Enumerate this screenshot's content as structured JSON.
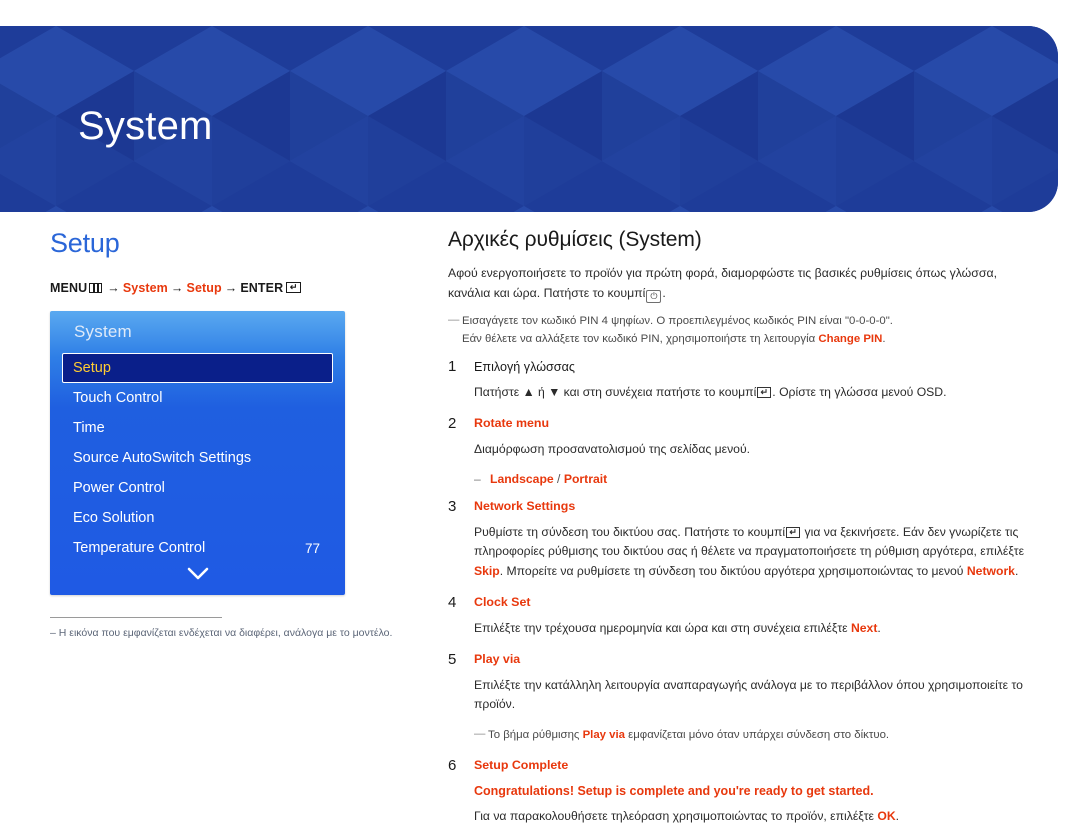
{
  "header": {
    "title": "System",
    "bg_color": "#1e3d99"
  },
  "left": {
    "section_title": "Setup",
    "breadcrumb": {
      "menu_label": "MENU",
      "menu_icon": "grid-lines-icon",
      "arrow": "→",
      "crumb1": "System",
      "crumb2": "Setup",
      "enter_label": "ENTER",
      "enter_icon": "enter-key-icon"
    },
    "osd": {
      "title": "System",
      "items": [
        {
          "label": "Setup",
          "value": "",
          "selected": true
        },
        {
          "label": "Touch Control",
          "value": "",
          "selected": false
        },
        {
          "label": "Time",
          "value": "",
          "selected": false
        },
        {
          "label": "Source AutoSwitch Settings",
          "value": "",
          "selected": false
        },
        {
          "label": "Power Control",
          "value": "",
          "selected": false
        },
        {
          "label": "Eco Solution",
          "value": "",
          "selected": false
        },
        {
          "label": "Temperature Control",
          "value": "77",
          "selected": false
        }
      ],
      "scroll_down_icon": "chevron-down-icon"
    },
    "footnote": "–  Η εικόνα που εμφανίζεται ενδέχεται να διαφέρει, ανάλογα με το μοντέλο."
  },
  "right": {
    "title": "Αρχικές ρυθμίσεις (System)",
    "intro_part1": "Αφού ενεργοποιήσετε το προϊόν για πρώτη φορά, διαμορφώστε τις βασικές ρυθμίσεις όπως γλώσσα, κανάλια και ώρα. Πατήστε το κουμπί",
    "intro_part2": ".",
    "power_icon": "power-button-icon",
    "pin_note_line1": "Εισαγάγετε τον κωδικό PIN 4 ψηφίων. Ο προεπιλεγμένος κωδικός PIN είναι \"0-0-0-0\".",
    "pin_note_line2_a": "Εάν θέλετε να αλλάξετε τον κωδικό PIN, χρησιμοποιήστε τη λειτουργία",
    "pin_note_line2_red": "Change PIN",
    "pin_note_line2_b": ".",
    "steps": [
      {
        "num": "1",
        "head": "Επιλογή γλώσσας",
        "head_red": false,
        "body_a": "Πατήστε ▲ ή ▼ και στη συνέχεια πατήστε το κουμπί",
        "body_b": ". Ορίστε τη γλώσσα μενού OSD."
      },
      {
        "num": "2",
        "head": "Rotate menu",
        "head_red": true,
        "body_a": "Διαμόρφωση προσανατολισμού της σελίδας μενού.",
        "bullet_left": "Landscape",
        "bullet_sep": " / ",
        "bullet_right": "Portrait"
      },
      {
        "num": "3",
        "head": "Network Settings",
        "head_red": true,
        "body_a": "Ρυθμίστε τη σύνδεση του δικτύου σας. Πατήστε το κουμπί",
        "body_b": " για να ξεκινήσετε. Εάν δεν γνωρίζετε τις πληροφορίες ρύθμισης του δικτύου σας ή θέλετε να πραγματοποιήσετε τη ρύθμιση αργότερα, επιλέξτε ",
        "body_red1": "Skip",
        "body_c": ". Μπορείτε να ρυθμίσετε τη σύνδεση του δικτύου αργότερα χρησιμοποιώντας το μενού ",
        "body_red2": "Network",
        "body_d": "."
      },
      {
        "num": "4",
        "head": "Clock Set",
        "head_red": true,
        "body_a": "Επιλέξτε την τρέχουσα ημερομηνία και ώρα και στη συνέχεια επιλέξτε ",
        "body_red1": "Next",
        "body_b": "."
      },
      {
        "num": "5",
        "head": "Play via",
        "head_red": true,
        "body_a": "Επιλέξτε την κατάλληλη λειτουργία αναπαραγωγής ανάλογα με το περιβάλλον όπου χρησιμοποιείτε το προϊόν.",
        "note_a": "Το βήμα ρύθμισης ",
        "note_red": "Play via",
        "note_b": " εμφανίζεται μόνο όταν υπάρχει σύνδεση στο δίκτυο."
      },
      {
        "num": "6",
        "head": "Setup Complete",
        "head_red": true,
        "congrats": "Congratulations! Setup is complete and you're ready to get started.",
        "body_a": "Για να παρακολουθήσετε τηλεόραση χρησιμοποιώντας το προϊόν, επιλέξτε ",
        "body_red1": "OK",
        "body_b": "."
      }
    ]
  },
  "colors": {
    "accent_red": "#e8380d",
    "accent_blue": "#2a66d8",
    "osd_highlight": "#0a1f8a",
    "osd_highlight_text": "#ffcc33"
  }
}
